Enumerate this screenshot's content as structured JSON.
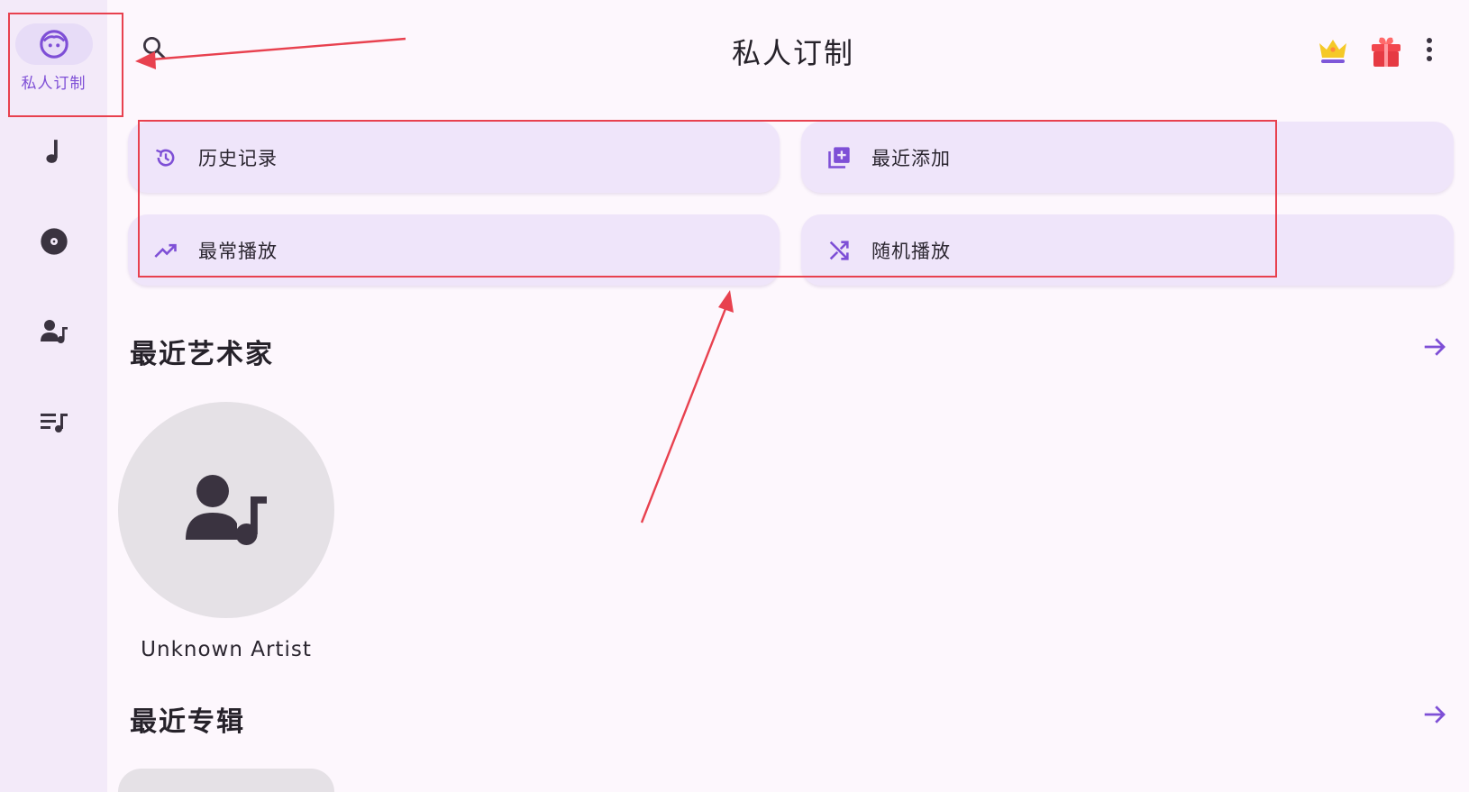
{
  "sidebar": {
    "items": [
      {
        "id": "personal",
        "label": "私人订制",
        "icon": "face-icon",
        "active": true
      },
      {
        "id": "songs",
        "icon": "music-note-icon"
      },
      {
        "id": "albums",
        "icon": "album-disc-icon"
      },
      {
        "id": "artists",
        "icon": "artist-icon"
      },
      {
        "id": "playlists",
        "icon": "playlist-icon"
      }
    ]
  },
  "header": {
    "title": "私人订制",
    "search_icon": "search-icon",
    "crown_icon": "crown-icon",
    "gift_icon": "gift-icon",
    "more_icon": "more-vertical-icon"
  },
  "quick_actions": {
    "history": {
      "label": "历史记录",
      "icon": "history-icon"
    },
    "recently_added": {
      "label": "最近添加",
      "icon": "library-add-icon"
    },
    "most_played": {
      "label": "最常播放",
      "icon": "trending-up-icon"
    },
    "shuffle": {
      "label": "随机播放",
      "icon": "shuffle-icon"
    }
  },
  "sections": {
    "recent_artists": {
      "title": "最近艺术家",
      "arrow_icon": "arrow-right-icon",
      "artists": [
        {
          "name": "Unknown Artist"
        }
      ]
    },
    "recent_albums": {
      "title": "最近专辑",
      "arrow_icon": "arrow-right-icon"
    }
  },
  "colors": {
    "accent": "#7e4fd6",
    "sidebar_bg": "#f3eaf9",
    "page_bg": "#fdf7fd",
    "card_bg": "#efe5fa",
    "annotation_red": "#e8414f"
  }
}
